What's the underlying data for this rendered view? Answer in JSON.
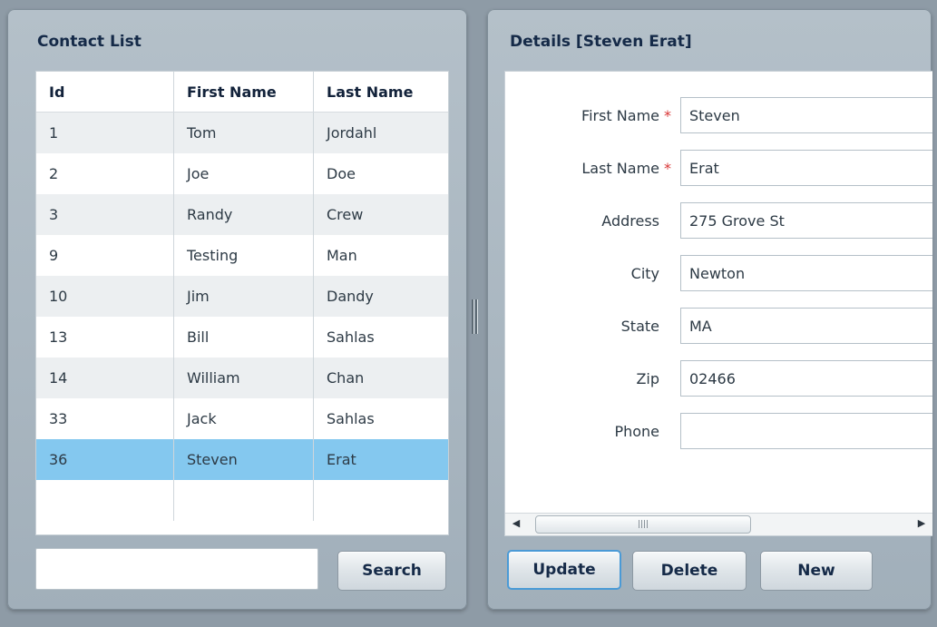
{
  "contact_list": {
    "title": "Contact List",
    "columns": [
      "Id",
      "First Name",
      "Last Name"
    ],
    "rows": [
      {
        "id": "1",
        "first": "Tom",
        "last": "Jordahl"
      },
      {
        "id": "2",
        "first": "Joe",
        "last": "Doe"
      },
      {
        "id": "3",
        "first": "Randy",
        "last": "Crew"
      },
      {
        "id": "9",
        "first": "Testing",
        "last": "Man"
      },
      {
        "id": "10",
        "first": "Jim",
        "last": "Dandy"
      },
      {
        "id": "13",
        "first": "Bill",
        "last": "Sahlas"
      },
      {
        "id": "14",
        "first": "William",
        "last": "Chan"
      },
      {
        "id": "33",
        "first": "Jack",
        "last": "Sahlas"
      },
      {
        "id": "36",
        "first": "Steven",
        "last": "Erat"
      }
    ],
    "selected_index": 8,
    "search": {
      "value": "",
      "button_label": "Search"
    }
  },
  "details": {
    "title": "Details [Steven Erat]",
    "fields": [
      {
        "label": "First Name",
        "value": "Steven",
        "required": true
      },
      {
        "label": "Last Name",
        "value": "Erat",
        "required": true
      },
      {
        "label": "Address",
        "value": "275 Grove St",
        "required": false
      },
      {
        "label": "City",
        "value": "Newton",
        "required": false
      },
      {
        "label": "State",
        "value": "MA",
        "required": false
      },
      {
        "label": "Zip",
        "value": "02466",
        "required": false
      },
      {
        "label": "Phone",
        "value": "",
        "required": false
      }
    ],
    "required_marker": "*",
    "buttons": {
      "update": "Update",
      "delete": "Delete",
      "new": "New"
    }
  },
  "icons": {
    "scroll_left": "arrow-left-icon",
    "scroll_right": "arrow-right-icon",
    "scroll_grip": "grip-icon",
    "splitter_grip": "splitter-grip-icon"
  },
  "colors": {
    "selected_row": "#84c8ef",
    "required_marker": "#d93636",
    "focus_border": "#4a9ad6"
  }
}
